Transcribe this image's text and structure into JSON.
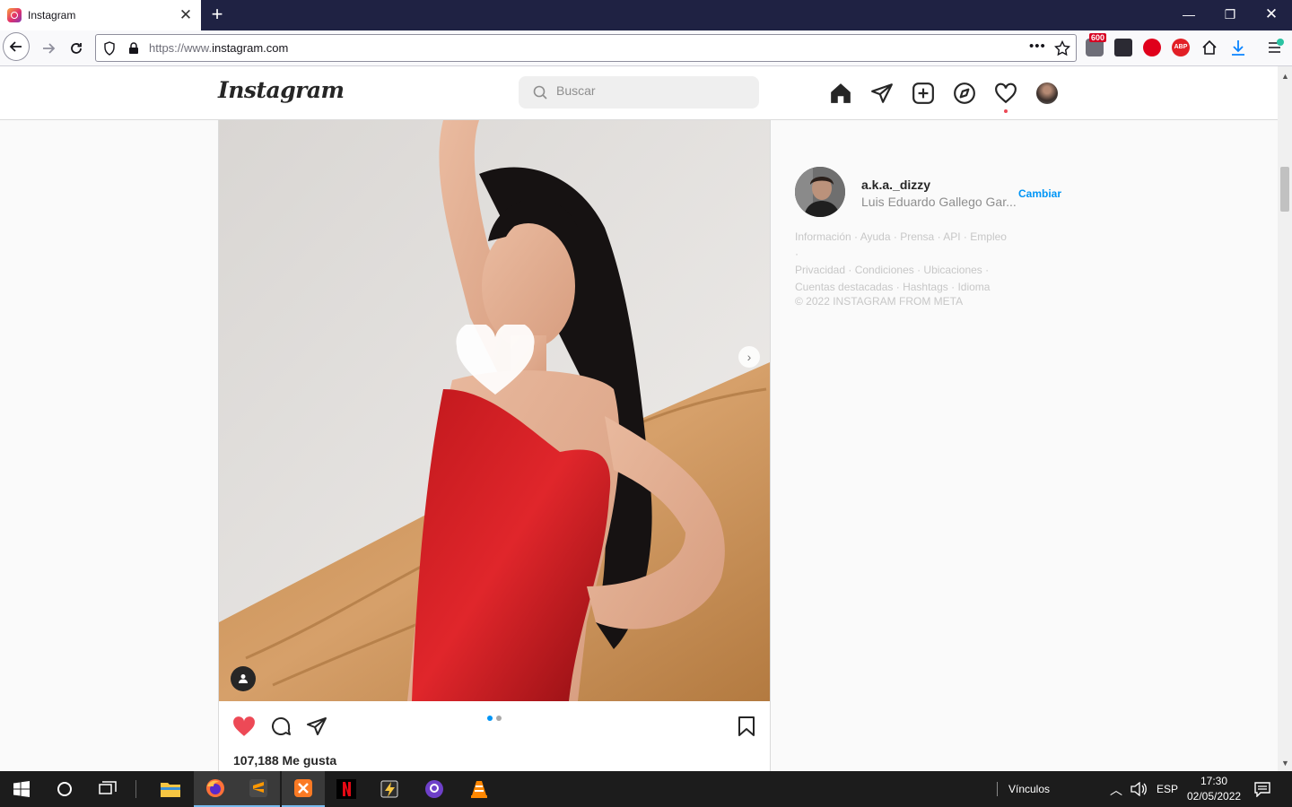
{
  "browser": {
    "tab_title": "Instagram",
    "url_scheme": "https://www.",
    "url_domain": "instagram.com",
    "badge_count": "600"
  },
  "header": {
    "logo": "Instagram",
    "search_placeholder": "Buscar"
  },
  "post": {
    "likes": "107,188 Me gusta"
  },
  "sidebar": {
    "username": "a.k.a._dizzy",
    "full_name": "Luis Eduardo Gallego Gar...",
    "switch_label": "Cambiar",
    "footer_links": [
      "Información",
      "Ayuda",
      "Prensa",
      "API",
      "Empleo",
      "Privacidad",
      "Condiciones",
      "Ubicaciones",
      "Cuentas destacadas",
      "Hashtags",
      "Idioma"
    ],
    "copyright": "© 2022 INSTAGRAM FROM META"
  },
  "taskbar": {
    "links_label": "Vínculos",
    "language": "ESP",
    "time": "17:30",
    "date": "02/05/2022"
  },
  "colors": {
    "accent_blue": "#0095f6",
    "like_red": "#ed4956",
    "tabstrip": "#1f2243"
  }
}
